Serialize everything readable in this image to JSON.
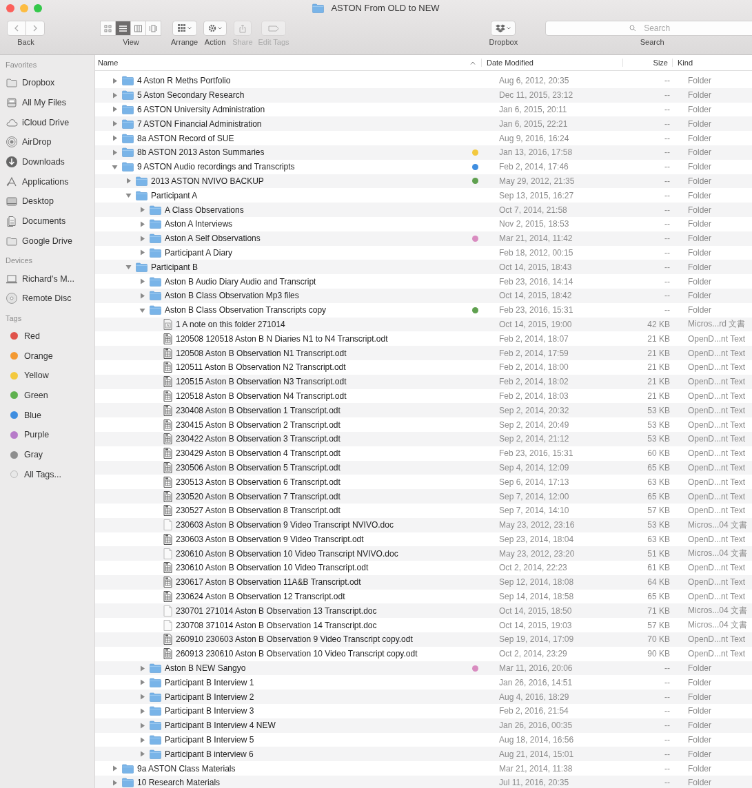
{
  "window": {
    "title": "ASTON From OLD to NEW"
  },
  "toolbar": {
    "back": {
      "label": "Back"
    },
    "view": {
      "label": "View",
      "segments": [
        {
          "selected": false
        },
        {
          "selected": true
        },
        {
          "selected": false
        },
        {
          "selected": false
        }
      ]
    },
    "arrange": {
      "label": "Arrange"
    },
    "action": {
      "label": "Action"
    },
    "share": {
      "label": "Share",
      "disabled": true
    },
    "edit_tags": {
      "label": "Edit Tags",
      "disabled": true
    },
    "dropbox": {
      "label": "Dropbox"
    },
    "search": {
      "placeholder": "Search",
      "label": "Search"
    }
  },
  "sidebar": {
    "sections": [
      {
        "title": "Favorites",
        "items": [
          {
            "label": "Dropbox"
          },
          {
            "label": "All My Files"
          },
          {
            "label": "iCloud Drive"
          },
          {
            "label": "AirDrop"
          },
          {
            "label": "Downloads"
          },
          {
            "label": "Applications"
          },
          {
            "label": "Desktop"
          },
          {
            "label": "Documents"
          },
          {
            "label": "Google Drive"
          }
        ]
      },
      {
        "title": "Devices",
        "items": [
          {
            "label": "Richard's M..."
          },
          {
            "label": "Remote Disc"
          }
        ]
      },
      {
        "title": "Tags",
        "tags": [
          {
            "label": "Red",
            "color": "#e0534b"
          },
          {
            "label": "Orange",
            "color": "#f39a33"
          },
          {
            "label": "Yellow",
            "color": "#f3c93f"
          },
          {
            "label": "Green",
            "color": "#5fb14f"
          },
          {
            "label": "Blue",
            "color": "#3f8ee0"
          },
          {
            "label": "Purple",
            "color": "#b77bc9"
          },
          {
            "label": "Gray",
            "color": "#8e8e8e"
          },
          {
            "label": "All Tags..."
          }
        ]
      }
    ]
  },
  "columns": {
    "name": "Name",
    "date": "Date Modified",
    "size": "Size",
    "kind": "Kind"
  },
  "rows": [
    {
      "kind": "folder",
      "name": "4 Aston R Meths Portfolio",
      "date": "Aug 6, 2012, 20:35",
      "size": "--",
      "kind_column": "Folder",
      "expanded": false
    },
    {
      "kind": "folder",
      "name": "5 Aston Secondary Research",
      "date": "Dec 11, 2015, 23:12",
      "size": "--",
      "kind_column": "Folder",
      "expanded": false
    },
    {
      "kind": "folder",
      "name": "6 ASTON University Administration",
      "date": "Jan 6, 2015, 20:11",
      "size": "--",
      "kind_column": "Folder",
      "expanded": false
    },
    {
      "kind": "folder",
      "name": "7 ASTON Financial Administration",
      "date": "Jan 6, 2015, 22:21",
      "size": "--",
      "kind_column": "Folder",
      "expanded": false
    },
    {
      "kind": "folder",
      "name": "8a ASTON Record of SUE",
      "date": "Aug 9, 2016, 16:24",
      "size": "--",
      "kind_column": "Folder",
      "expanded": false
    },
    {
      "kind": "folder",
      "name": "8b ASTON 2013 Aston Summaries",
      "date": "Jan 13, 2016, 17:58",
      "size": "--",
      "kind_column": "Folder",
      "expanded": false,
      "color": "#f3c93f"
    },
    {
      "kind": "folder",
      "name": "9 ASTON Audio recordings and Transcripts",
      "date": "Feb 2, 2014, 17:46",
      "size": "--",
      "kind_column": "Folder",
      "expanded": true,
      "color": "#3f8ee0",
      "children": [
        {
          "kind": "folder",
          "name": "2013 ASTON NVIVO BACKUP",
          "date": "May 29, 2012, 21:35",
          "size": "--",
          "kind_column": "Folder",
          "expanded": false,
          "color": "#5fa04f"
        },
        {
          "kind": "folder",
          "name": "Participant A",
          "date": "Sep 13, 2015, 16:27",
          "size": "--",
          "kind_column": "Folder",
          "expanded": true,
          "children": [
            {
              "kind": "folder",
              "name": "A Class Observations",
              "date": "Oct 7, 2014, 21:58",
              "size": "--",
              "kind_column": "Folder",
              "expanded": false
            },
            {
              "kind": "folder",
              "name": "Aston A Interviews",
              "date": "Nov 2, 2015, 18:53",
              "size": "--",
              "kind_column": "Folder",
              "expanded": false
            },
            {
              "kind": "folder",
              "name": "Aston A Self Observations",
              "date": "Mar 21, 2014, 11:42",
              "size": "--",
              "kind_column": "Folder",
              "expanded": false,
              "color": "#d98cc0"
            },
            {
              "kind": "folder",
              "name": "Participant A Diary",
              "date": "Feb 18, 2012, 00:15",
              "size": "--",
              "kind_column": "Folder",
              "expanded": false
            }
          ]
        },
        {
          "kind": "folder",
          "name": "Participant B",
          "date": "Oct 14, 2015, 18:43",
          "size": "--",
          "kind_column": "Folder",
          "expanded": true,
          "children": [
            {
              "kind": "folder",
              "name": "Aston B Audio Diary Audio and Transcript",
              "date": "Feb 23, 2016, 14:14",
              "size": "--",
              "kind_column": "Folder",
              "expanded": false
            },
            {
              "kind": "folder",
              "name": "Aston B Class Observation Mp3 files",
              "date": "Oct 14, 2015, 18:42",
              "size": "--",
              "kind_column": "Folder",
              "expanded": false
            },
            {
              "kind": "folder",
              "name": "Aston B Class Observation Transcripts copy",
              "date": "Feb 23, 2016, 15:31",
              "size": "--",
              "kind_column": "Folder",
              "expanded": true,
              "color": "#5fa04f",
              "children": [
                {
                  "kind": "note",
                  "name": "1 A note on this folder 271014",
                  "date": "Oct 14, 2015, 19:00",
                  "size": "42 KB",
                  "kind_column": "Micros...rd 文書"
                },
                {
                  "kind": "odt",
                  "name": "120508 120518 Aston B N Diaries N1 to N4 Transcript.odt",
                  "date": "Feb 2, 2014, 18:07",
                  "size": "21 KB",
                  "kind_column": "OpenD...nt Text"
                },
                {
                  "kind": "odt",
                  "name": "120508 Aston B Observation N1 Transcript.odt",
                  "date": "Feb 2, 2014, 17:59",
                  "size": "21 KB",
                  "kind_column": "OpenD...nt Text"
                },
                {
                  "kind": "odt",
                  "name": "120511 Aston B Observation N2 Transcript.odt",
                  "date": "Feb 2, 2014, 18:00",
                  "size": "21 KB",
                  "kind_column": "OpenD...nt Text"
                },
                {
                  "kind": "odt",
                  "name": "120515 Aston B Observation N3 Transcript.odt",
                  "date": "Feb 2, 2014, 18:02",
                  "size": "21 KB",
                  "kind_column": "OpenD...nt Text"
                },
                {
                  "kind": "odt",
                  "name": "120518 Aston B Observation N4 Transcript.odt",
                  "date": "Feb 2, 2014, 18:03",
                  "size": "21 KB",
                  "kind_column": "OpenD...nt Text"
                },
                {
                  "kind": "odt",
                  "name": "230408 Aston B Observation 1 Transcript.odt",
                  "date": "Sep 2, 2014, 20:32",
                  "size": "53 KB",
                  "kind_column": "OpenD...nt Text"
                },
                {
                  "kind": "odt",
                  "name": "230415 Aston B Observation 2 Transcript.odt",
                  "date": "Sep 2, 2014, 20:49",
                  "size": "53 KB",
                  "kind_column": "OpenD...nt Text"
                },
                {
                  "kind": "odt",
                  "name": "230422 Aston B Observation 3 Transcript.odt",
                  "date": "Sep 2, 2014, 21:12",
                  "size": "53 KB",
                  "kind_column": "OpenD...nt Text"
                },
                {
                  "kind": "odt",
                  "name": "230429 Aston B Observation 4 Transcript.odt",
                  "date": "Feb 23, 2016, 15:31",
                  "size": "60 KB",
                  "kind_column": "OpenD...nt Text"
                },
                {
                  "kind": "odt",
                  "name": "230506 Aston B Observation 5 Transcript.odt",
                  "date": "Sep 4, 2014, 12:09",
                  "size": "65 KB",
                  "kind_column": "OpenD...nt Text"
                },
                {
                  "kind": "odt",
                  "name": "230513 Aston B Observation 6 Transcript.odt",
                  "date": "Sep 6, 2014, 17:13",
                  "size": "63 KB",
                  "kind_column": "OpenD...nt Text"
                },
                {
                  "kind": "odt",
                  "name": "230520 Aston B Observation 7 Transcript.odt",
                  "date": "Sep 7, 2014, 12:00",
                  "size": "65 KB",
                  "kind_column": "OpenD...nt Text"
                },
                {
                  "kind": "odt",
                  "name": "230527 Aston B Observation 8 Transcript.odt",
                  "date": "Sep 7, 2014, 14:10",
                  "size": "57 KB",
                  "kind_column": "OpenD...nt Text"
                },
                {
                  "kind": "doc",
                  "name": "230603 Aston B Observation 9 Video Transcript NVIVO.doc",
                  "date": "May 23, 2012, 23:16",
                  "size": "53 KB",
                  "kind_column": "Micros...04 文書"
                },
                {
                  "kind": "odt",
                  "name": "230603 Aston B Observation 9 Video Transcript.odt",
                  "date": "Sep 23, 2014, 18:04",
                  "size": "63 KB",
                  "kind_column": "OpenD...nt Text"
                },
                {
                  "kind": "doc",
                  "name": "230610 Aston B Observation 10 Video Transcript NVIVO.doc",
                  "date": "May 23, 2012, 23:20",
                  "size": "51 KB",
                  "kind_column": "Micros...04 文書"
                },
                {
                  "kind": "odt",
                  "name": "230610 Aston B Observation 10 Video Transcript.odt",
                  "date": "Oct 2, 2014, 22:23",
                  "size": "61 KB",
                  "kind_column": "OpenD...nt Text"
                },
                {
                  "kind": "odt",
                  "name": "230617 Aston B Observation 11A&B Transcript.odt",
                  "date": "Sep 12, 2014, 18:08",
                  "size": "64 KB",
                  "kind_column": "OpenD...nt Text"
                },
                {
                  "kind": "odt",
                  "name": "230624 Aston B Observation 12 Transcript.odt",
                  "date": "Sep 14, 2014, 18:58",
                  "size": "65 KB",
                  "kind_column": "OpenD...nt Text"
                },
                {
                  "kind": "doc",
                  "name": "230701 271014 Aston B Observation 13 Transcript.doc",
                  "date": "Oct 14, 2015, 18:50",
                  "size": "71 KB",
                  "kind_column": "Micros...04 文書"
                },
                {
                  "kind": "doc",
                  "name": "230708 371014 Aston B Observation 14 Transcript.doc",
                  "date": "Oct 14, 2015, 19:03",
                  "size": "57 KB",
                  "kind_column": "Micros...04 文書"
                },
                {
                  "kind": "odt",
                  "name": "260910 230603 Aston B Observation 9 Video Transcript copy.odt",
                  "date": "Sep 19, 2014, 17:09",
                  "size": "70 KB",
                  "kind_column": "OpenD...nt Text"
                },
                {
                  "kind": "odt",
                  "name": "260913 230610 Aston B Observation 10 Video Transcript copy.odt",
                  "date": "Oct 2, 2014, 23:29",
                  "size": "90 KB",
                  "kind_column": "OpenD...nt Text"
                }
              ]
            },
            {
              "kind": "folder",
              "name": "Aston B NEW Sangyo",
              "date": "Mar 11, 2016, 20:06",
              "size": "--",
              "kind_column": "Folder",
              "expanded": false,
              "color": "#d98cc0"
            },
            {
              "kind": "folder",
              "name": "Participant B Interview 1",
              "date": "Jan 26, 2016, 14:51",
              "size": "--",
              "kind_column": "Folder",
              "expanded": false
            },
            {
              "kind": "folder",
              "name": "Participant B Interview 2",
              "date": "Aug 4, 2016, 18:29",
              "size": "--",
              "kind_column": "Folder",
              "expanded": false
            },
            {
              "kind": "folder",
              "name": "Participant B Interview 3",
              "date": "Feb 2, 2016, 21:54",
              "size": "--",
              "kind_column": "Folder",
              "expanded": false
            },
            {
              "kind": "folder",
              "name": "Participant B Interview 4 NEW",
              "date": "Jan 26, 2016, 00:35",
              "size": "--",
              "kind_column": "Folder",
              "expanded": false
            },
            {
              "kind": "folder",
              "name": "Participant B Interview 5",
              "date": "Aug 18, 2014, 16:56",
              "size": "--",
              "kind_column": "Folder",
              "expanded": false
            },
            {
              "kind": "folder",
              "name": "Participant B interview 6",
              "date": "Aug 21, 2014, 15:01",
              "size": "--",
              "kind_column": "Folder",
              "expanded": false
            }
          ]
        }
      ]
    },
    {
      "kind": "folder",
      "name": "9a ASTON Class Materials",
      "date": "Mar 21, 2014, 11:38",
      "size": "--",
      "kind_column": "Folder",
      "expanded": false
    },
    {
      "kind": "folder",
      "name": "10 Research Materials",
      "date": "Jul 11, 2016, 20:35",
      "size": "--",
      "kind_column": "Folder",
      "expanded": false
    }
  ]
}
